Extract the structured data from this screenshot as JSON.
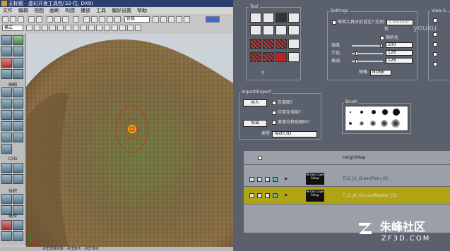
{
  "editor": {
    "title": "无标题 - 虚幻开发工具包(32-位, DX9)",
    "menu": [
      "文件",
      "编辑",
      "视图",
      "画刷",
      "构建",
      "播放",
      "工具",
      "偏好设置",
      "帮助"
    ],
    "toolbar": {
      "mode_select": "模式",
      "world_select": "世界"
    },
    "left_labels": [
      "画刷",
      "CSG",
      "体积",
      "选择"
    ],
    "status_text": "点击选择对象 · 点击放大 · 点击顶点"
  },
  "tool_window": {
    "tool_section": {
      "title": "Tool"
    },
    "settings_section": {
      "title": "Settings",
      "per_tool_label": "每种工具分别设定? 比例:",
      "scale_value": "1.000000",
      "lock_label": "锁",
      "gravity_label": "随机化",
      "strength_label": "强度:",
      "strength_value": "100",
      "radius_label": "半径:",
      "radius_value": "128",
      "falloff_label": "衰减:",
      "falloff_value": "128",
      "mirror_label": "镜像:",
      "mirror_value": "NONE"
    },
    "view_section": {
      "title": "View S"
    },
    "import_section": {
      "title": "Import/Export",
      "import_button": "导入",
      "export_button": "导出",
      "opt_bmp": "灰度图?",
      "opt_apply": "应用至当前?",
      "opt_fill": "奥德位移贴图吗?",
      "type_label": "类型",
      "type_value": "TextT3D"
    },
    "brush_section": {
      "title": "Brush"
    },
    "layers": {
      "header": "HeightMap",
      "rows": [
        {
          "name": "TLS_JX_GrassPlain_01",
          "thumb_label": "Terrain Layer Setup"
        },
        {
          "name": "T_G_JX_GroundMaster_02",
          "thumb_label": "Terrain Layer Setup"
        }
      ]
    }
  },
  "watermark": {
    "text": "朱峰社区",
    "url": "ZF3D.COM",
    "logo": "youku"
  },
  "colors": {
    "accent": "#b0a414",
    "panel": "#5b616c",
    "titlebar": "#2a3f6e"
  }
}
